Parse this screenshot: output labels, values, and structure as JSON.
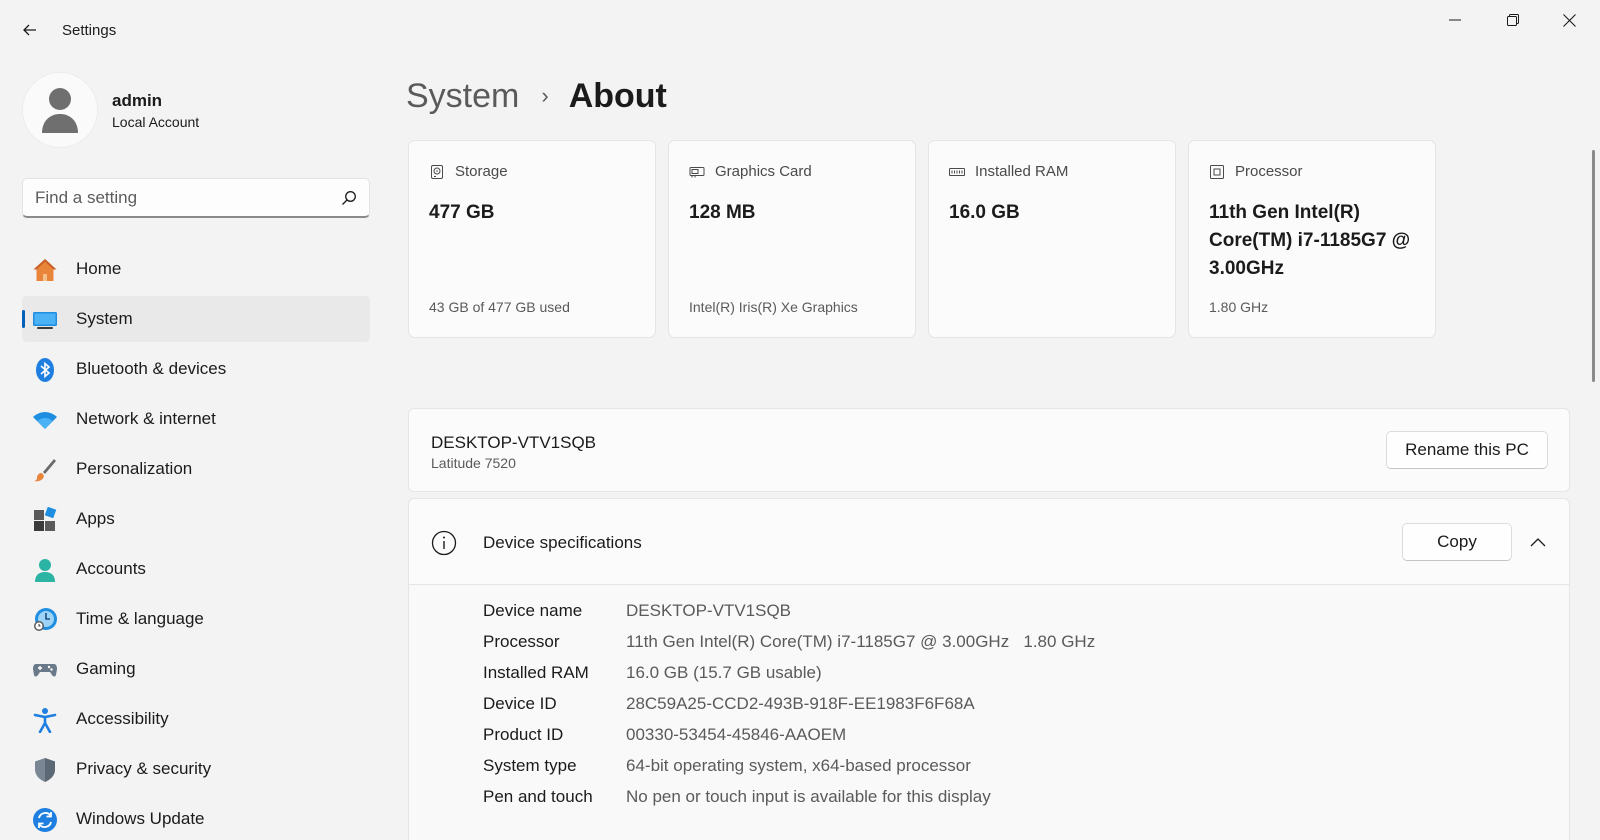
{
  "window": {
    "title": "Settings"
  },
  "profile": {
    "name": "admin",
    "account_type": "Local Account"
  },
  "search": {
    "placeholder": "Find a setting"
  },
  "sidebar": {
    "items": [
      {
        "label": "Home",
        "icon": "home-icon",
        "active": false
      },
      {
        "label": "System",
        "icon": "system-icon",
        "active": true
      },
      {
        "label": "Bluetooth & devices",
        "icon": "bluetooth-icon",
        "active": false
      },
      {
        "label": "Network & internet",
        "icon": "wifi-icon",
        "active": false
      },
      {
        "label": "Personalization",
        "icon": "brush-icon",
        "active": false
      },
      {
        "label": "Apps",
        "icon": "apps-icon",
        "active": false
      },
      {
        "label": "Accounts",
        "icon": "accounts-icon",
        "active": false
      },
      {
        "label": "Time & language",
        "icon": "time-language-icon",
        "active": false
      },
      {
        "label": "Gaming",
        "icon": "gamepad-icon",
        "active": false
      },
      {
        "label": "Accessibility",
        "icon": "accessibility-icon",
        "active": false
      },
      {
        "label": "Privacy & security",
        "icon": "shield-icon",
        "active": false
      },
      {
        "label": "Windows Update",
        "icon": "update-icon",
        "active": false
      }
    ]
  },
  "breadcrumb": {
    "parent": "System",
    "separator": "›",
    "current": "About"
  },
  "cards": [
    {
      "title": "Storage",
      "value": "477 GB",
      "detail": "43 GB of 477 GB used",
      "icon": "storage-icon"
    },
    {
      "title": "Graphics Card",
      "value": "128 MB",
      "detail": "Intel(R) Iris(R) Xe Graphics",
      "icon": "graphics-card-icon"
    },
    {
      "title": "Installed RAM",
      "value": "16.0 GB",
      "detail": "",
      "icon": "ram-icon"
    },
    {
      "title": "Processor",
      "value": "11th Gen Intel(R) Core(TM) i7-1185G7 @ 3.00GHz",
      "detail": "1.80 GHz",
      "icon": "processor-icon"
    }
  ],
  "pc": {
    "name": "DESKTOP-VTV1SQB",
    "model": "Latitude 7520",
    "rename_label": "Rename this PC"
  },
  "specs": {
    "title": "Device specifications",
    "copy_label": "Copy",
    "rows": [
      {
        "label": "Device name",
        "value": "DESKTOP-VTV1SQB"
      },
      {
        "label": "Processor",
        "value": "11th Gen Intel(R) Core(TM) i7-1185G7 @ 3.00GHz   1.80 GHz"
      },
      {
        "label": "Installed RAM",
        "value": "16.0 GB (15.7 GB usable)"
      },
      {
        "label": "Device ID",
        "value": "28C59A25-CCD2-493B-918F-EE1983F6F68A"
      },
      {
        "label": "Product ID",
        "value": "00330-53454-45846-AAOEM"
      },
      {
        "label": "System type",
        "value": "64-bit operating system, x64-based processor"
      },
      {
        "label": "Pen and touch",
        "value": "No pen or touch input is available for this display"
      }
    ]
  },
  "colors": {
    "accent": "#005fb8",
    "background": "#f3f3f3"
  }
}
